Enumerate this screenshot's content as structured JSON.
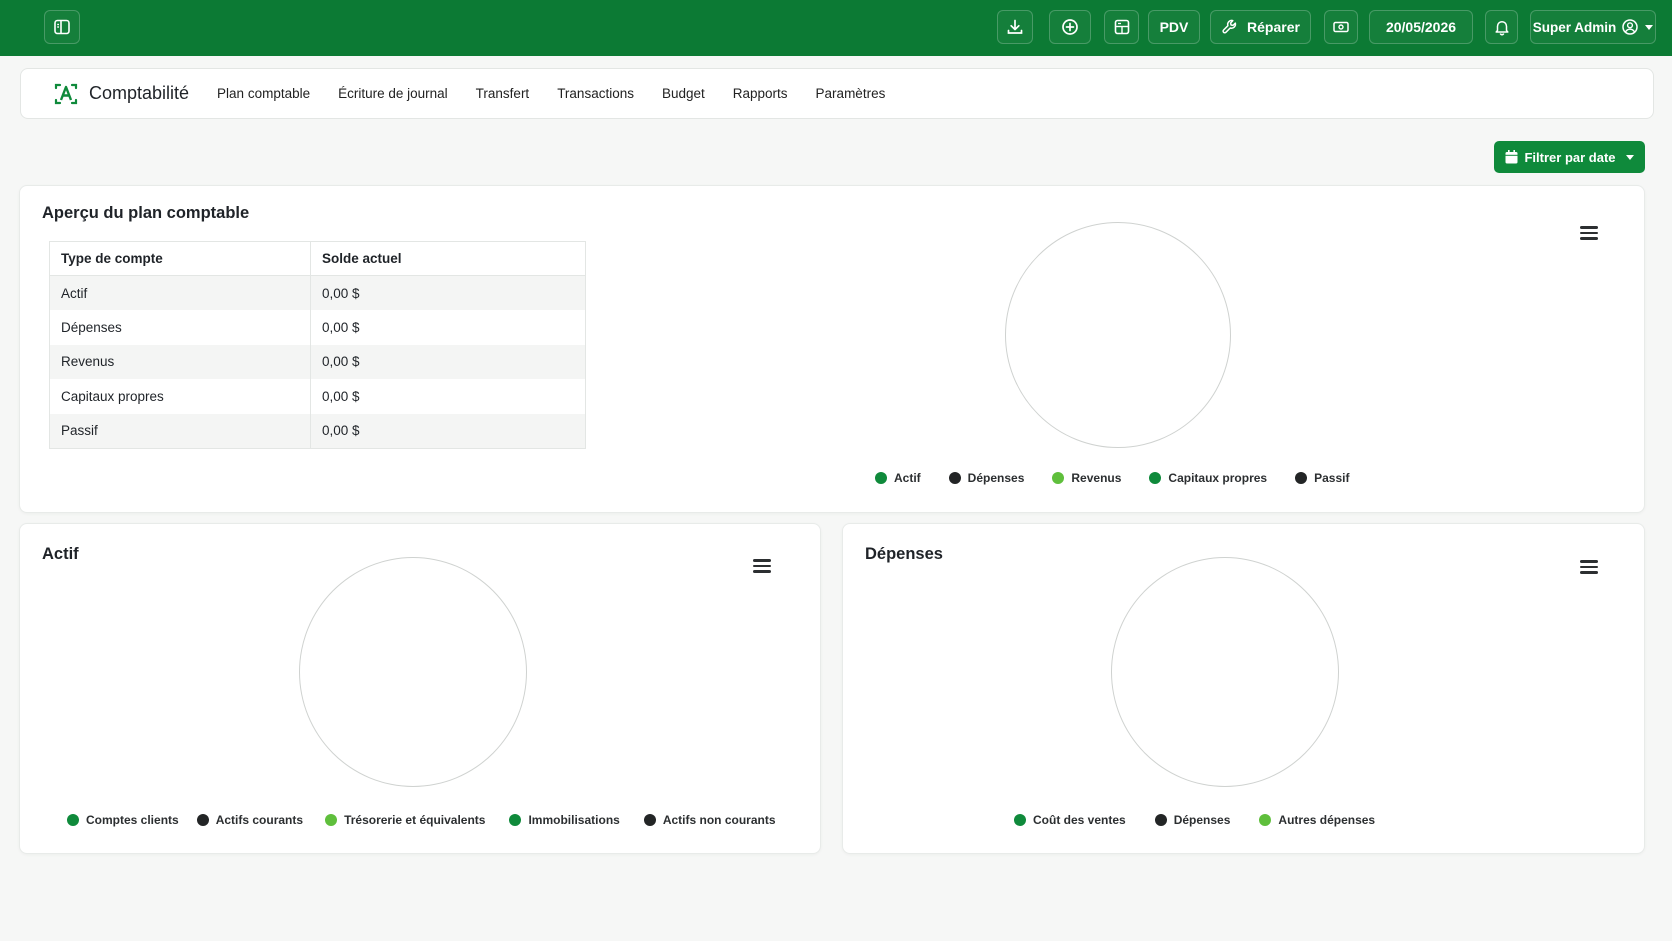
{
  "topbar": {
    "pos_label": "PDV",
    "repair_label": "Réparer",
    "date": "20/05/2026",
    "user_label": "Super Admin"
  },
  "app": {
    "title": "Comptabilité",
    "nav": [
      "Plan comptable",
      "Écriture de journal",
      "Transfert",
      "Transactions",
      "Budget",
      "Rapports",
      "Paramètres"
    ]
  },
  "filter": {
    "label": "Filtrer par date"
  },
  "overview": {
    "title": "Aperçu du plan comptable",
    "table": {
      "headers": [
        "Type de compte",
        "Solde actuel"
      ],
      "rows": [
        [
          "Actif",
          "0,00 $"
        ],
        [
          "Dépenses",
          "0,00 $"
        ],
        [
          "Revenus",
          "0,00 $"
        ],
        [
          "Capitaux propres",
          "0,00 $"
        ],
        [
          "Passif",
          "0,00 $"
        ]
      ]
    },
    "legend": [
      {
        "label": "Actif",
        "color": "#0f8a3b"
      },
      {
        "label": "Dépenses",
        "color": "#232526"
      },
      {
        "label": "Revenus",
        "color": "#5fbf3c"
      },
      {
        "label": "Capitaux propres",
        "color": "#0f8a3b"
      },
      {
        "label": "Passif",
        "color": "#232526"
      }
    ]
  },
  "actif": {
    "title": "Actif",
    "legend": [
      {
        "label": "Comptes clients",
        "color": "#0f8a3b"
      },
      {
        "label": "Actifs courants",
        "color": "#232526"
      },
      {
        "label": "Trésorerie et équivalents",
        "color": "#5fbf3c"
      },
      {
        "label": "Immobilisations",
        "color": "#0f8a3b"
      },
      {
        "label": "Actifs non courants",
        "color": "#232526"
      }
    ]
  },
  "depenses": {
    "title": "Dépenses",
    "legend": [
      {
        "label": "Coût des ventes",
        "color": "#0f8a3b"
      },
      {
        "label": "Dépenses",
        "color": "#232526"
      },
      {
        "label": "Autres dépenses",
        "color": "#5fbf3c"
      }
    ]
  }
}
